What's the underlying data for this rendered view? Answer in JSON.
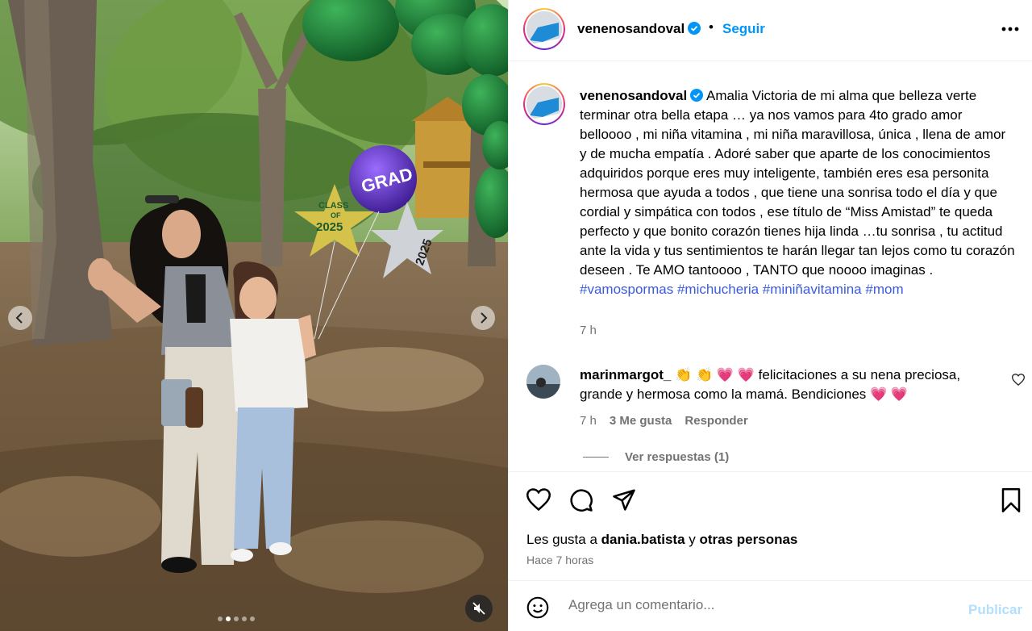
{
  "post": {
    "username": "venenosandoval",
    "follow_label": "Seguir",
    "separator": "•"
  },
  "caption": {
    "username": "venenosandoval",
    "text": "Amalia Victoria de mi alma que belleza verte terminar otra bella etapa … ya nos vamos para 4to grado amor belloooo , mi niña vitamina , mi niña maravillosa, única , llena de amor y de mucha empatía . Adoré saber que aparte de los conocimientos adquiridos porque eres muy inteligente, también eres esa personita hermosa que ayuda a todos , que tiene una sonrisa todo el día y que cordial y simpática con todos , ese título de “Miss Amistad” te queda perfecto y que bonito corazón tienes hija linda …tu sonrisa , tu actitud ante la vida y tus sentimientos te harán llegar tan lejos como tu corazón deseen . Te AMO tantoooo , TANTO que noooo imaginas . ",
    "hashtags": [
      "#vamospormas",
      "#michucheria",
      "#miniñavitamina",
      "#mom"
    ],
    "time": "7 h"
  },
  "comments": [
    {
      "username": "marinmargot_",
      "text": " 👏 👏 💗 💗  felicitaciones a su nena preciosa, grande y hermosa como la mamá. Bendiciones 💗 💗",
      "time": "7 h",
      "likes": "3 Me gusta",
      "reply_label": "Responder",
      "view_replies": "Ver respuestas (1)"
    }
  ],
  "likes": {
    "prefix": "Les gusta a ",
    "user": "dania.batista",
    "middle": " y ",
    "others": "otras personas"
  },
  "post_time": "Hace 7 horas",
  "composer": {
    "placeholder": "Agrega un comentario...",
    "publish_label": "Publicar"
  },
  "carousel": {
    "total": 5,
    "active_index": 1
  },
  "photo": {
    "balloon_text": "GRAD",
    "star_text_1": "CLASS",
    "star_text_2": "OF",
    "star_text_3": "2025",
    "silver_text": "2025"
  },
  "colors": {
    "accent": "#0095f6",
    "hashtag": "#3b5bdb",
    "muted": "#737373",
    "balloon_green": "#1e8a3a"
  }
}
